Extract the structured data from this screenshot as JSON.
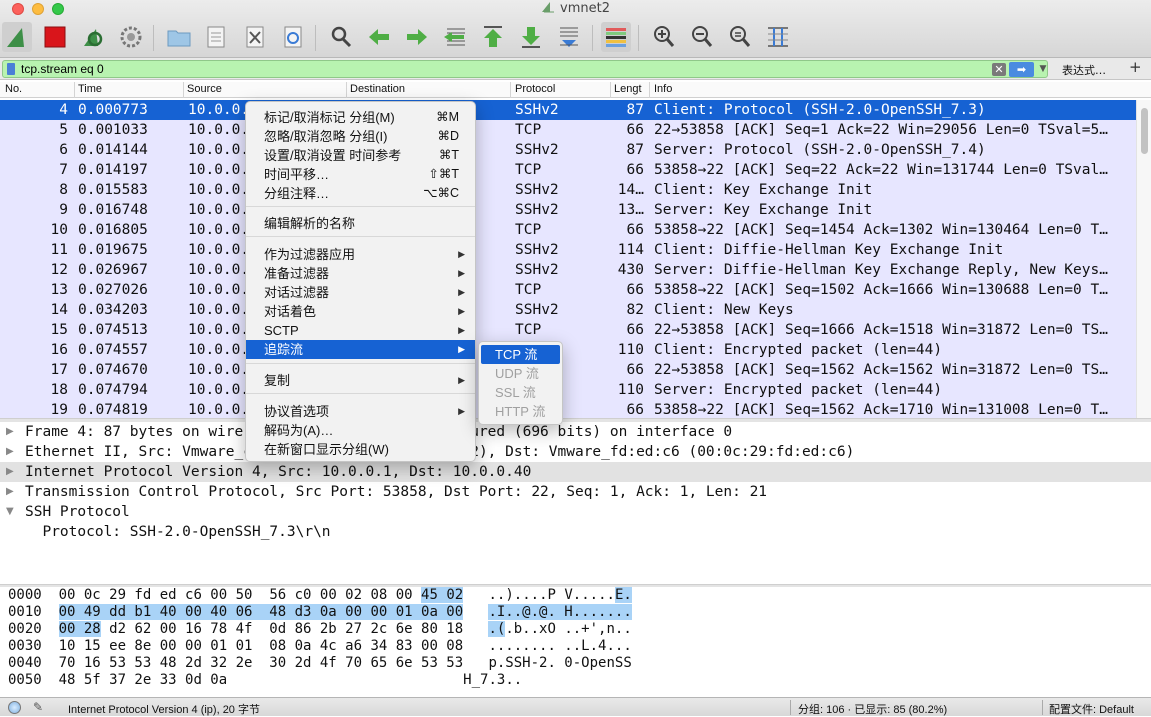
{
  "window": {
    "title": "vmnet2"
  },
  "filter": {
    "value": "tcp.stream eq 0",
    "expressions_label": "表达式…",
    "add_label": "+"
  },
  "columns": [
    "No.",
    "Time",
    "Source",
    "Destination",
    "Protocol",
    "Lengt",
    "Info"
  ],
  "packets": [
    {
      "no": "4",
      "time": "0.000773",
      "src": "10.0.0.",
      "proto": "SSHv2",
      "len": "87",
      "info": "Client: Protocol (SSH-2.0-OpenSSH_7.3)"
    },
    {
      "no": "5",
      "time": "0.001033",
      "src": "10.0.0.",
      "proto": "TCP",
      "len": "66",
      "info": "22→53858 [ACK] Seq=1 Ack=22 Win=29056 Len=0 TSval=5…"
    },
    {
      "no": "6",
      "time": "0.014144",
      "src": "10.0.0.",
      "proto": "SSHv2",
      "len": "87",
      "info": "Server: Protocol (SSH-2.0-OpenSSH_7.4)"
    },
    {
      "no": "7",
      "time": "0.014197",
      "src": "10.0.0.",
      "proto": "TCP",
      "len": "66",
      "info": "53858→22 [ACK] Seq=22 Ack=22 Win=131744 Len=0 TSval…"
    },
    {
      "no": "8",
      "time": "0.015583",
      "src": "10.0.0.",
      "proto": "SSHv2",
      "len": "14…",
      "info": "Client: Key Exchange Init"
    },
    {
      "no": "9",
      "time": "0.016748",
      "src": "10.0.0.",
      "proto": "SSHv2",
      "len": "13…",
      "info": "Server: Key Exchange Init"
    },
    {
      "no": "10",
      "time": "0.016805",
      "src": "10.0.0.",
      "proto": "TCP",
      "len": "66",
      "info": "53858→22 [ACK] Seq=1454 Ack=1302 Win=130464 Len=0 T…"
    },
    {
      "no": "11",
      "time": "0.019675",
      "src": "10.0.0.",
      "proto": "SSHv2",
      "len": "114",
      "info": "Client: Diffie-Hellman Key Exchange Init"
    },
    {
      "no": "12",
      "time": "0.026967",
      "src": "10.0.0.",
      "proto": "SSHv2",
      "len": "430",
      "info": "Server: Diffie-Hellman Key Exchange Reply, New Keys…"
    },
    {
      "no": "13",
      "time": "0.027026",
      "src": "10.0.0.",
      "proto": "TCP",
      "len": "66",
      "info": "53858→22 [ACK] Seq=1502 Ack=1666 Win=130688 Len=0 T…"
    },
    {
      "no": "14",
      "time": "0.034203",
      "src": "10.0.0.",
      "proto": "SSHv2",
      "len": "82",
      "info": "Client: New Keys"
    },
    {
      "no": "15",
      "time": "0.074513",
      "src": "10.0.0.",
      "proto": "TCP",
      "len": "66",
      "info": "22→53858 [ACK] Seq=1666 Ack=1518 Win=31872 Len=0 TS…"
    },
    {
      "no": "16",
      "time": "0.074557",
      "src": "10.0.0.",
      "proto": "",
      "len": "110",
      "info": "Client: Encrypted packet (len=44)"
    },
    {
      "no": "17",
      "time": "0.074670",
      "src": "10.0.0.",
      "proto": "",
      "len": "66",
      "info": "22→53858 [ACK] Seq=1562 Ack=1562 Win=31872 Len=0 TS…"
    },
    {
      "no": "18",
      "time": "0.074794",
      "src": "10.0.0.",
      "proto": "",
      "len": "110",
      "info": "Server: Encrypted packet (len=44)"
    },
    {
      "no": "19",
      "time": "0.074819",
      "src": "10.0.0.",
      "proto": "",
      "len": "66",
      "info": "53858→22 [ACK] Seq=1562 Ack=1710 Win=131008 Len=0 T…"
    }
  ],
  "details": [
    {
      "toggle": "▶",
      "text": "Frame 4: 87 bytes on wire (696 bits), 87 bytes captured (696 bits) on interface 0"
    },
    {
      "toggle": "▶",
      "text": "Ethernet II, Src: Vmware_c0:00:02 (00:50:56:c0:00:02), Dst: Vmware_fd:ed:c6 (00:0c:29:fd:ed:c6)"
    },
    {
      "toggle": "▶",
      "text": "Internet Protocol Version 4, Src: 10.0.0.1, Dst: 10.0.0.40"
    },
    {
      "toggle": "▶",
      "text": "Transmission Control Protocol, Src Port: 53858, Dst Port: 22, Seq: 1, Ack: 1, Len: 21"
    },
    {
      "toggle": "▼",
      "text": "SSH Protocol"
    },
    {
      "toggle": "",
      "text": "  Protocol: SSH-2.0-OpenSSH_7.3\\r\\n"
    }
  ],
  "bytes": [
    {
      "offset": "0000",
      "hex_a": "00 0c 29 fd ed c6 00 50",
      "hex_b": "56 c0 00 02 08 00",
      "hex_b_hl": "45 02",
      "ascii_a": "..)....P V.....",
      "ascii_hl": "E."
    },
    {
      "offset": "0010",
      "hex_hl": "00 49 dd b1 40 00 40 06  48 d3 0a 00 00 01 0a 00",
      "ascii_hl": ".I..@.@. H......."
    },
    {
      "offset": "0020",
      "hex_hl": "00 28",
      "hex_rest": " d2 62 00 16 78 4f  0d 86 2b 27 2c 6e 80 18",
      "ascii_hl": ".(",
      "ascii_rest": ".b..xO ..+',n.."
    },
    {
      "offset": "0030",
      "hex_rest": "10 15 ee 8e 00 00 01 01  08 0a 4c a6 34 83 00 08",
      "ascii_rest": "........ ..L.4..."
    },
    {
      "offset": "0040",
      "hex_rest": "70 16 53 53 48 2d 32 2e  30 2d 4f 70 65 6e 53 53",
      "ascii_rest": "p.SSH-2. 0-OpenSS"
    },
    {
      "offset": "0050",
      "hex_rest": "48 5f 37 2e 33 0d 0a",
      "ascii_rest": "H_7.3.."
    }
  ],
  "context_menu": {
    "items": [
      {
        "label": "标记/取消标记 分组(M)",
        "shortcut": "⌘M"
      },
      {
        "label": "忽略/取消忽略 分组(I)",
        "shortcut": "⌘D"
      },
      {
        "label": "设置/取消设置 时间参考",
        "shortcut": "⌘T"
      },
      {
        "label": "时间平移…",
        "shortcut": "⇧⌘T"
      },
      {
        "label": "分组注释…",
        "shortcut": "⌥⌘C"
      },
      {
        "label": "编辑解析的名称"
      },
      {
        "label": "作为过滤器应用",
        "arrow": "▶"
      },
      {
        "label": "准备过滤器",
        "arrow": "▶"
      },
      {
        "label": "对话过滤器",
        "arrow": "▶"
      },
      {
        "label": "对话着色",
        "arrow": "▶"
      },
      {
        "label": "SCTP",
        "arrow": "▶"
      },
      {
        "label": "追踪流",
        "arrow": "▶"
      },
      {
        "label": "复制",
        "arrow": "▶"
      },
      {
        "label": "协议首选项",
        "arrow": "▶"
      },
      {
        "label": "解码为(A)…"
      },
      {
        "label": "在新窗口显示分组(W)"
      }
    ]
  },
  "submenu": {
    "items": [
      "TCP 流",
      "UDP 流",
      "SSL 流",
      "HTTP 流"
    ]
  },
  "status": {
    "left": "Internet Protocol Version 4 (ip), 20 字节",
    "counts": "分组: 106 · 已显示: 85 (80.2%)",
    "profile": "配置文件: Default"
  },
  "colors": {
    "selection": "#1662d3",
    "row_bg": "#e7e6ff",
    "filter_ok": "#b8f3b0",
    "byte_highlight": "#a9d3f7"
  }
}
